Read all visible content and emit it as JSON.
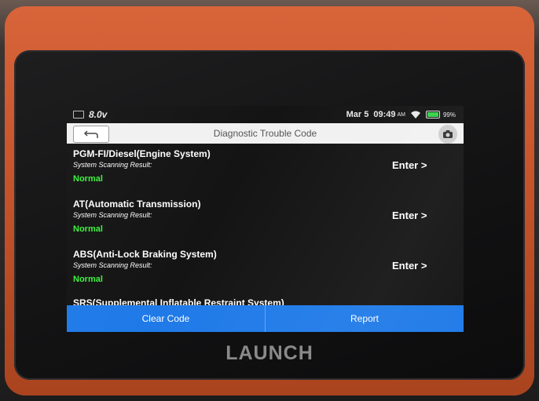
{
  "status_bar": {
    "voltage": "8.0v",
    "date": "Mar 5",
    "time": "09:49",
    "ampm": "AM",
    "battery_percent": "99%"
  },
  "header": {
    "title": "Diagnostic Trouble Code"
  },
  "systems": [
    {
      "name": "PGM-FI/Diesel(Engine System)",
      "scan_label": "System Scanning Result:",
      "result": "Normal",
      "enter_label": "Enter >"
    },
    {
      "name": "AT(Automatic Transmission)",
      "scan_label": "System Scanning Result:",
      "result": "Normal",
      "enter_label": "Enter >"
    },
    {
      "name": "ABS(Anti-Lock Braking System)",
      "scan_label": "System Scanning Result:",
      "result": "Normal",
      "enter_label": "Enter >"
    },
    {
      "name": "SRS(Supplemental Inflatable Restraint System)"
    }
  ],
  "bottom_bar": {
    "clear_code": "Clear Code",
    "report": "Report"
  },
  "device": {
    "brand": "LAUNCH"
  },
  "colors": {
    "accent_blue": "#1f7ae8",
    "normal_green": "#3cf23c",
    "casing_orange": "#c9552c"
  }
}
